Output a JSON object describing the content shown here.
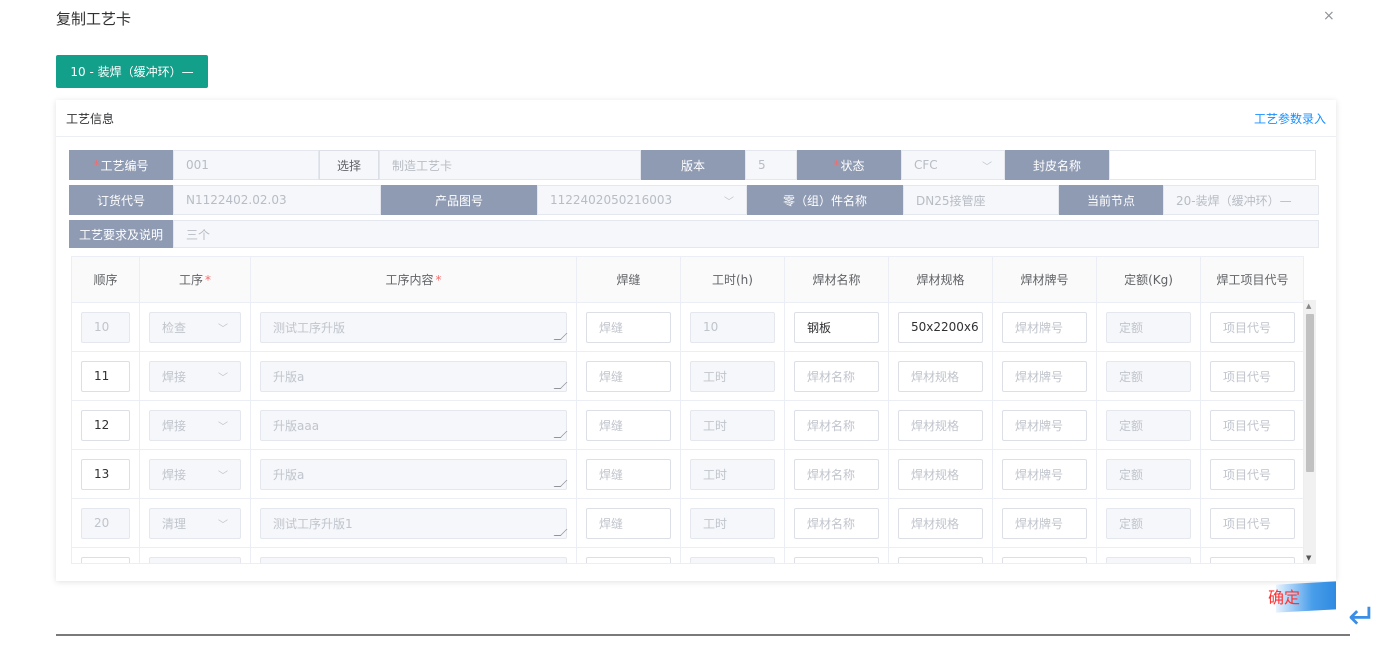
{
  "dialog": {
    "title": "复制工艺卡",
    "close": "×"
  },
  "tab": {
    "label": "10 - 装焊（缓冲环）—"
  },
  "panel": {
    "title": "工艺信息",
    "link": "工艺参数录入"
  },
  "form": {
    "craft_no_label": "工艺编号",
    "craft_no": "001",
    "select_btn": "选择",
    "card_name_placeholder": "制造工艺卡",
    "version_label": "版本",
    "version": "5",
    "status_label": "状态",
    "status": "CFC",
    "cover_name_label": "封皮名称",
    "cover_name": "",
    "order_no_label": "订货代号",
    "order_no": "N1122402.02.03",
    "product_no_label": "产品图号",
    "product_no": "1122402050216003",
    "part_name_label": "零（组）件名称",
    "part_name": "DN25接管座",
    "node_label": "当前节点",
    "node": "20-装焊（缓冲环）—",
    "req_label": "工艺要求及说明",
    "req": "三个"
  },
  "table": {
    "headers": [
      "顺序",
      "工序",
      "工序内容",
      "焊缝",
      "工时(h)",
      "焊材名称",
      "焊材规格",
      "焊材牌号",
      "定额(Kg)",
      "焊工项目代号"
    ],
    "placeholders": {
      "weld": "焊缝",
      "hours": "工时",
      "mat_name": "焊材名称",
      "mat_spec": "焊材规格",
      "mat_brand": "焊材牌号",
      "quota": "定额",
      "project": "项目代号"
    },
    "rows": [
      {
        "seq": "10",
        "proc": "检查",
        "content": "测试工序升版",
        "weld": "",
        "hours": "10",
        "mat_name": "钢板",
        "mat_spec": "50x2200x6"
      },
      {
        "seq": "11",
        "proc": "焊接",
        "content": "升版a",
        "weld": "",
        "hours": "",
        "mat_name": "",
        "mat_spec": ""
      },
      {
        "seq": "12",
        "proc": "焊接",
        "content": "升版aaa",
        "weld": "",
        "hours": "",
        "mat_name": "",
        "mat_spec": ""
      },
      {
        "seq": "13",
        "proc": "焊接",
        "content": "升版a",
        "weld": "",
        "hours": "",
        "mat_name": "",
        "mat_spec": ""
      },
      {
        "seq": "20",
        "proc": "清理",
        "content": "测试工序升版1",
        "weld": "",
        "hours": "",
        "mat_name": "",
        "mat_spec": ""
      }
    ]
  },
  "footer": {
    "confirm": "确定",
    "enter_icon": "↵"
  }
}
